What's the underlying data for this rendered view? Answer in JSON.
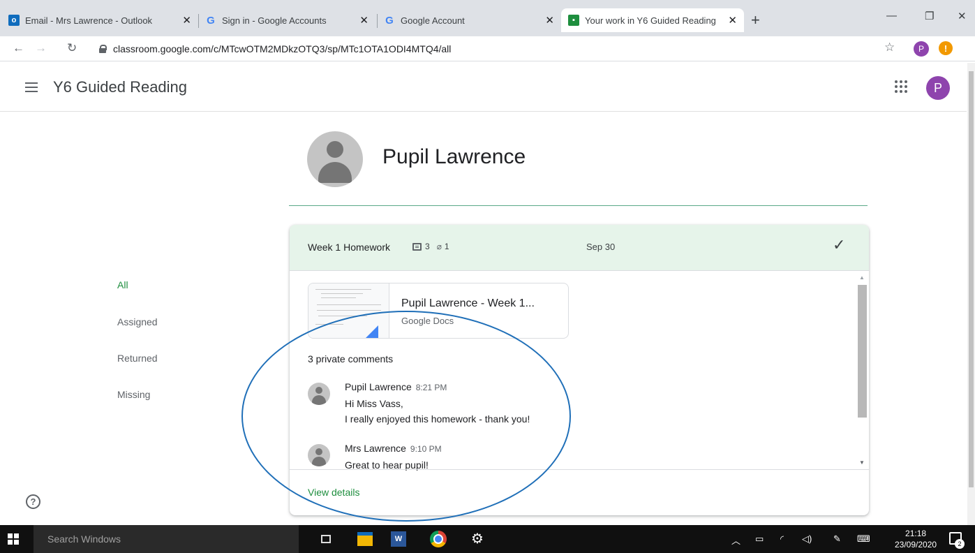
{
  "browser": {
    "tabs": [
      {
        "title": "Email - Mrs Lawrence - Outlook",
        "favicon": "outlook-icon",
        "active": false
      },
      {
        "title": "Sign in - Google Accounts",
        "favicon": "google-icon",
        "active": false
      },
      {
        "title": "Google Account",
        "favicon": "google-icon",
        "active": false
      },
      {
        "title": "Your work in Y6 Guided Reading",
        "favicon": "classroom-icon",
        "active": true
      }
    ],
    "url": "classroom.google.com/c/MTcwOTM2MDkzOTQ3/sp/MTc1OTA1ODI4MTQ4/all",
    "profile_initial": "P",
    "alert_glyph": "!"
  },
  "app": {
    "class_title": "Y6 Guided Reading",
    "account_initial": "P"
  },
  "student": {
    "name": "Pupil Lawrence"
  },
  "filters": [
    {
      "label": "All",
      "active": true
    },
    {
      "label": "Assigned",
      "active": false
    },
    {
      "label": "Returned",
      "active": false
    },
    {
      "label": "Missing",
      "active": false
    }
  ],
  "assignment": {
    "title": "Week 1 Homework",
    "comment_count": "3",
    "attachment_count": "1",
    "date": "Sep 30",
    "status_icon": "checkmark-icon",
    "attachment": {
      "title": "Pupil Lawrence - Week 1...",
      "type": "Google Docs"
    },
    "comments_heading": "3 private comments",
    "comments": [
      {
        "author": "Pupil Lawrence",
        "time": "8:21 PM",
        "lines": [
          "Hi Miss Vass,",
          "I really enjoyed this homework - thank you!"
        ]
      },
      {
        "author": "Mrs Lawrence",
        "time": "9:10 PM",
        "lines": [
          "Great to hear pupil!"
        ]
      }
    ],
    "view_details": "View details"
  },
  "taskbar": {
    "search_placeholder": "Search Windows",
    "time": "21:18",
    "date": "23/09/2020",
    "notification_count": "2",
    "word_glyph": "W"
  },
  "colors": {
    "accent_green": "#1e8e3e",
    "card_header_bg": "#e6f4ea",
    "annotation_circle": "#1f6fb8",
    "avatar_purple": "#8e44ad"
  }
}
